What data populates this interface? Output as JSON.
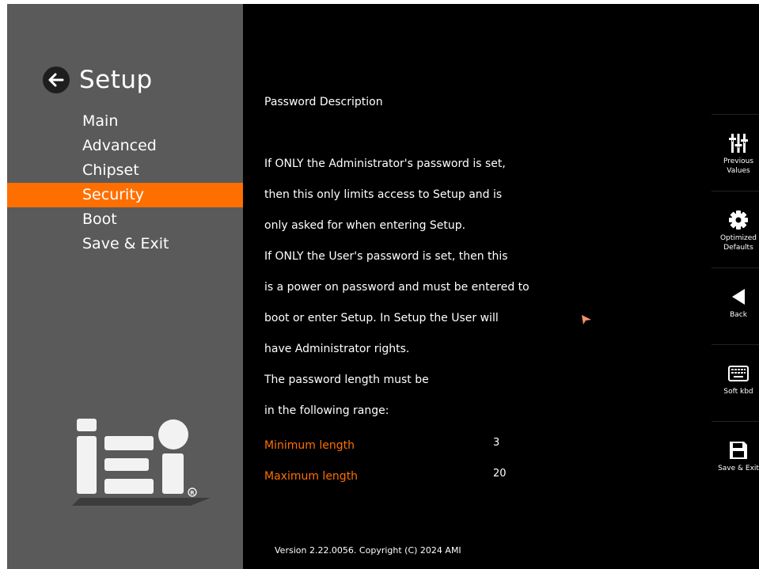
{
  "sidebar": {
    "title": "Setup",
    "items": [
      {
        "label": "Main"
      },
      {
        "label": "Advanced"
      },
      {
        "label": "Chipset"
      },
      {
        "label": "Security"
      },
      {
        "label": "Boot"
      },
      {
        "label": "Save & Exit"
      }
    ],
    "active_item": "Security",
    "logo_text": "iEi",
    "logo_mark": "®"
  },
  "help": {
    "title": "Password Description",
    "lines": [
      "If ONLY the Administrator's password is set,",
      "then this only limits access to Setup and is",
      "only asked for when entering Setup.",
      "If ONLY the User's password is set, then this",
      "is a power on password and must be entered to",
      "boot or enter Setup. In Setup the User will",
      "have Administrator rights.",
      "The password length must be",
      "in the following range:"
    ],
    "range": [
      {
        "label": "Minimum length",
        "value": "3"
      },
      {
        "label": "Maximum length",
        "value": "20"
      }
    ]
  },
  "footer": {
    "version": "Version 2.22.0056. Copyright (C) 2024 AMI"
  },
  "toolbar": {
    "items": [
      {
        "label": "Previous\nValues",
        "icon": "sliders-icon"
      },
      {
        "label": "Optimized\nDefaults",
        "icon": "gear-icon"
      },
      {
        "label": "Back",
        "icon": "back-triangle-icon"
      },
      {
        "label": "Soft kbd",
        "icon": "keyboard-icon"
      },
      {
        "label": "Save & Exit",
        "icon": "floppy-disk-icon"
      }
    ]
  },
  "colors": {
    "accent": "#ff6f00",
    "sidebar_bg": "#5a5a5a",
    "content_bg": "#000000",
    "text": "#ffffff"
  }
}
